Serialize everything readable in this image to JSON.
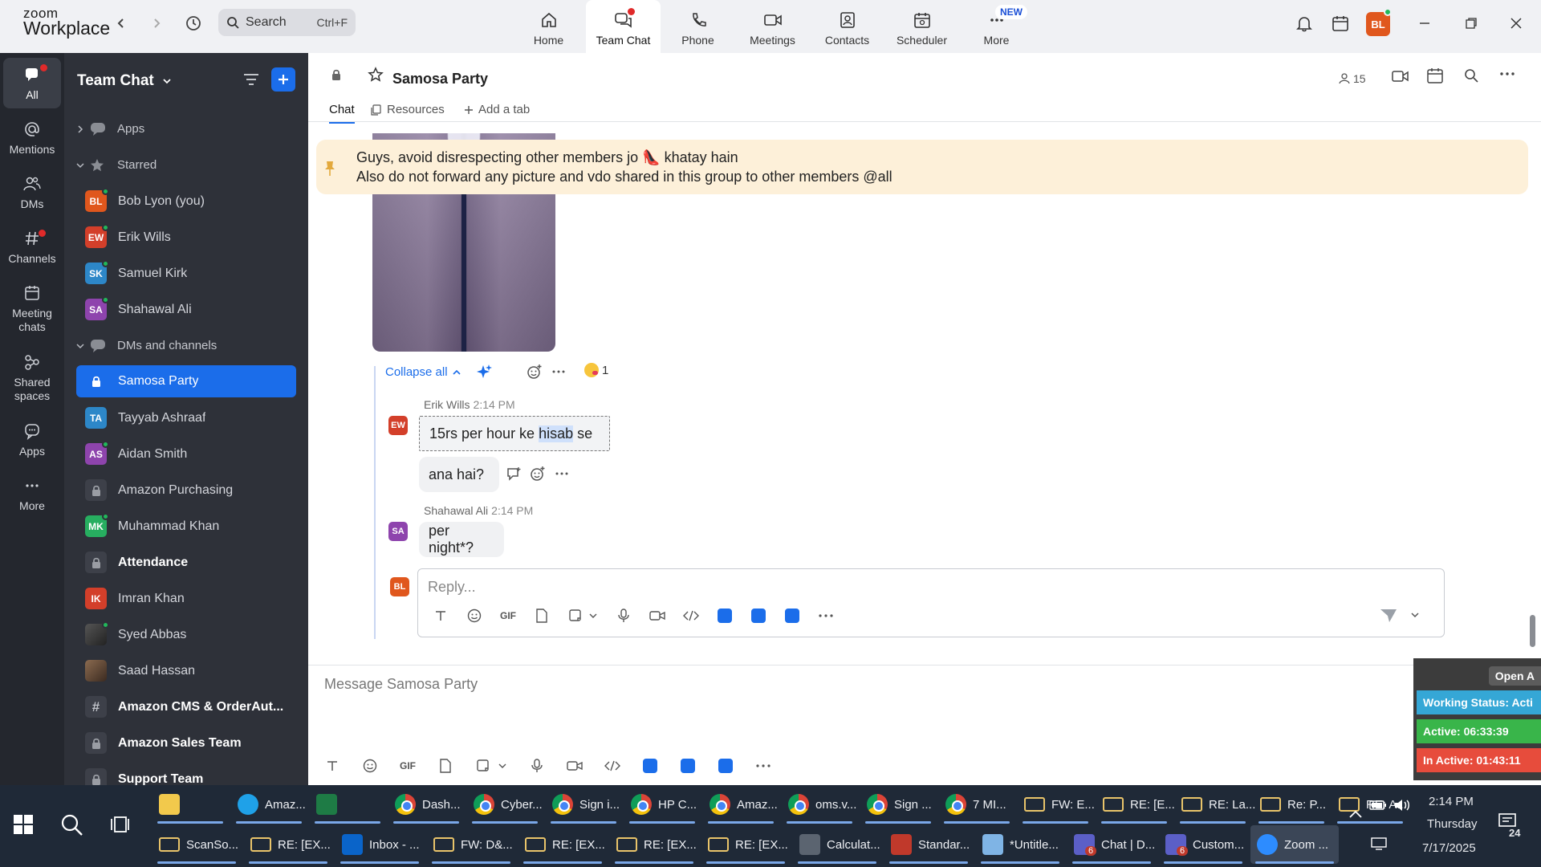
{
  "app": {
    "logo_line1": "zoom",
    "logo_line2": "Workplace"
  },
  "search": {
    "placeholder": "Search",
    "shortcut": "Ctrl+F"
  },
  "top_tabs": [
    {
      "label": "Home",
      "icon": "home-icon"
    },
    {
      "label": "Team Chat",
      "icon": "chat-icon"
    },
    {
      "label": "Phone",
      "icon": "phone-icon"
    },
    {
      "label": "Meetings",
      "icon": "video-icon"
    },
    {
      "label": "Contacts",
      "icon": "contacts-icon"
    },
    {
      "label": "Scheduler",
      "icon": "calendar-icon"
    },
    {
      "label": "More",
      "icon": "more-icon"
    }
  ],
  "more_badge": "NEW",
  "user_initials": "BL",
  "rail": [
    {
      "label": "All"
    },
    {
      "label": "Mentions"
    },
    {
      "label": "DMs"
    },
    {
      "label": "Channels"
    },
    {
      "label": "Meeting chats"
    },
    {
      "label": "Shared spaces"
    },
    {
      "label": "Apps"
    },
    {
      "label": "More"
    }
  ],
  "sidebar": {
    "title": "Team Chat",
    "sections": {
      "apps": "Apps",
      "starred": "Starred",
      "dms": "DMs and channels"
    },
    "starred": [
      {
        "name": "Bob Lyon (you)",
        "initials": "BL",
        "color": "#e0571d"
      },
      {
        "name": "Erik Wills",
        "initials": "EW",
        "color": "#d33f2a"
      },
      {
        "name": "Samuel Kirk",
        "initials": "SK",
        "color": "#2d87c8"
      },
      {
        "name": "Shahawal Ali",
        "initials": "SA",
        "color": "#8e44ad"
      }
    ],
    "channels": [
      {
        "name": "Samosa Party",
        "kind": "lock",
        "selected": true
      },
      {
        "name": "Tayyab Ashraaf",
        "kind": "avatar",
        "initials": "TA",
        "color": "#2d87c8"
      },
      {
        "name": "Aidan Smith",
        "kind": "avatar",
        "initials": "AS",
        "color": "#8e44ad"
      },
      {
        "name": "Amazon Purchasing",
        "kind": "lock"
      },
      {
        "name": "Muhammad Khan",
        "kind": "avatar",
        "initials": "MK",
        "color": "#27ae60"
      },
      {
        "name": "Attendance",
        "kind": "lock",
        "bold": true
      },
      {
        "name": "Imran Khan",
        "kind": "avatar",
        "initials": "IK",
        "color": "#d33f2a"
      },
      {
        "name": "Syed Abbas",
        "kind": "photo",
        "color": "#3b3b3b"
      },
      {
        "name": "Saad Hassan",
        "kind": "photo",
        "color": "#6b4f3a"
      },
      {
        "name": "Amazon CMS & OrderAut...",
        "kind": "hash",
        "bold": true
      },
      {
        "name": "Amazon Sales Team",
        "kind": "lock",
        "bold": true
      },
      {
        "name": "Support Team",
        "kind": "lock",
        "bold": true
      }
    ]
  },
  "channel": {
    "name": "Samosa Party",
    "members": "15",
    "tabs": {
      "chat": "Chat",
      "resources": "Resources",
      "add": "Add a tab"
    }
  },
  "pinned": {
    "line1": "Guys, avoid disrespecting other members jo 👠 khatay hain",
    "line2": "Also do not forward any picture and vdo shared in this group to other members @all"
  },
  "thread": {
    "collapse_label": "Collapse all",
    "reaction_count": "1",
    "messages": [
      {
        "sender": "Erik Wills",
        "time": "2:14 PM",
        "initials": "EW",
        "color": "#d33f2a",
        "line1_pre": "15rs per hour ke ",
        "line1_hl": "hisab",
        "line1_post": " se",
        "line2": "ana hai?"
      },
      {
        "sender": "Shahawal Ali",
        "time": "2:14 PM",
        "initials": "SA",
        "color": "#8e44ad",
        "text": "per night*?"
      }
    ],
    "reply_placeholder": "Reply...",
    "reply_avatar": "BL"
  },
  "compose": {
    "placeholder": "Message Samosa Party"
  },
  "widget": {
    "open_label": "Open A",
    "working_status": "Working Status: Acti",
    "active": "Active: 06:33:39",
    "inactive": "In Active: 01:43:11"
  },
  "colors": {
    "accent": "#1b6dea",
    "rail_bg": "#24272e",
    "sidebar_bg": "#2e3139",
    "pinned_bg": "#fdf0d9",
    "widget_blue": "#35a7d6",
    "widget_green": "#39b54a",
    "widget_red": "#e74c3c"
  },
  "taskbar": {
    "row1": [
      {
        "label": "",
        "kind": "folder"
      },
      {
        "label": "Amaz...",
        "kind": "edge"
      },
      {
        "label": "",
        "kind": "excel"
      },
      {
        "label": "Dash...",
        "kind": "chrome"
      },
      {
        "label": "Cyber...",
        "kind": "chrome"
      },
      {
        "label": "Sign i...",
        "kind": "chrome"
      },
      {
        "label": "HP C...",
        "kind": "chrome"
      },
      {
        "label": "Amaz...",
        "kind": "chrome"
      },
      {
        "label": "oms.v...",
        "kind": "chrome"
      },
      {
        "label": "Sign ...",
        "kind": "chrome"
      },
      {
        "label": "7 MI...",
        "kind": "chrome"
      },
      {
        "label": "FW: E...",
        "kind": "mail"
      },
      {
        "label": "RE: [E...",
        "kind": "mail"
      },
      {
        "label": "RE: La...",
        "kind": "mail"
      },
      {
        "label": "Re: P...",
        "kind": "mail"
      },
      {
        "label": "RE: A...",
        "kind": "mail"
      }
    ],
    "row2": [
      {
        "label": "ScanSo...",
        "kind": "mail"
      },
      {
        "label": "RE: [EX...",
        "kind": "mail"
      },
      {
        "label": "Inbox - ...",
        "kind": "outlook"
      },
      {
        "label": "FW: D&...",
        "kind": "mail"
      },
      {
        "label": "RE: [EX...",
        "kind": "mail"
      },
      {
        "label": "RE: [EX...",
        "kind": "mail"
      },
      {
        "label": "RE: [EX...",
        "kind": "mail"
      },
      {
        "label": "Calculat...",
        "kind": "calc"
      },
      {
        "label": "Standar...",
        "kind": "pdf"
      },
      {
        "label": "*Untitle...",
        "kind": "notepad"
      },
      {
        "label": "Chat | D...",
        "kind": "teams"
      },
      {
        "label": "Custom...",
        "kind": "teams"
      },
      {
        "label": "Zoom ...",
        "kind": "zoom"
      }
    ],
    "teams_badge": "6",
    "time": "2:14 PM",
    "day": "Thursday",
    "date": "7/17/2025",
    "notifications": "24"
  }
}
